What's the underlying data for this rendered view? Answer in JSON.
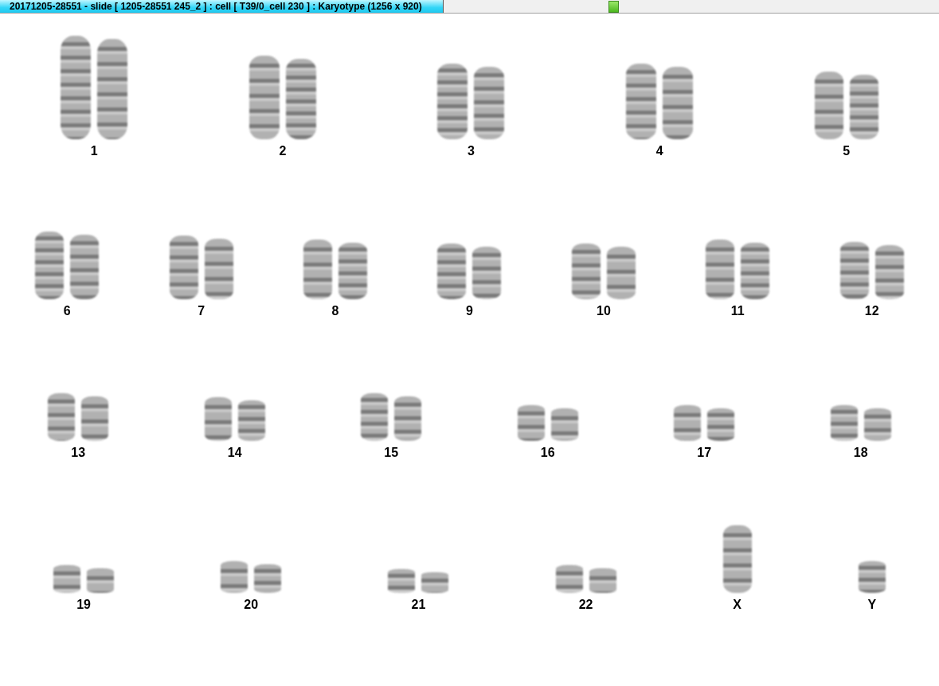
{
  "title_bar": {
    "title": "20171205-28551 - slide [ 1205-28551 245_2 ] : cell [ T39/0_cell 230 ] : Karyotype  (1256 x 920)"
  },
  "karyotype": {
    "chromosomes": [
      {
        "label": "1",
        "kind": "pair"
      },
      {
        "label": "2",
        "kind": "pair"
      },
      {
        "label": "3",
        "kind": "pair"
      },
      {
        "label": "4",
        "kind": "pair"
      },
      {
        "label": "5",
        "kind": "pair"
      },
      {
        "label": "6",
        "kind": "pair"
      },
      {
        "label": "7",
        "kind": "pair"
      },
      {
        "label": "8",
        "kind": "pair"
      },
      {
        "label": "9",
        "kind": "pair"
      },
      {
        "label": "10",
        "kind": "pair"
      },
      {
        "label": "11",
        "kind": "pair"
      },
      {
        "label": "12",
        "kind": "pair"
      },
      {
        "label": "13",
        "kind": "pair"
      },
      {
        "label": "14",
        "kind": "pair"
      },
      {
        "label": "15",
        "kind": "pair"
      },
      {
        "label": "16",
        "kind": "pair"
      },
      {
        "label": "17",
        "kind": "pair"
      },
      {
        "label": "18",
        "kind": "pair"
      },
      {
        "label": "19",
        "kind": "pair"
      },
      {
        "label": "20",
        "kind": "pair"
      },
      {
        "label": "21",
        "kind": "pair"
      },
      {
        "label": "22",
        "kind": "pair"
      },
      {
        "label": "X",
        "kind": "single"
      },
      {
        "label": "Y",
        "kind": "single"
      }
    ]
  }
}
